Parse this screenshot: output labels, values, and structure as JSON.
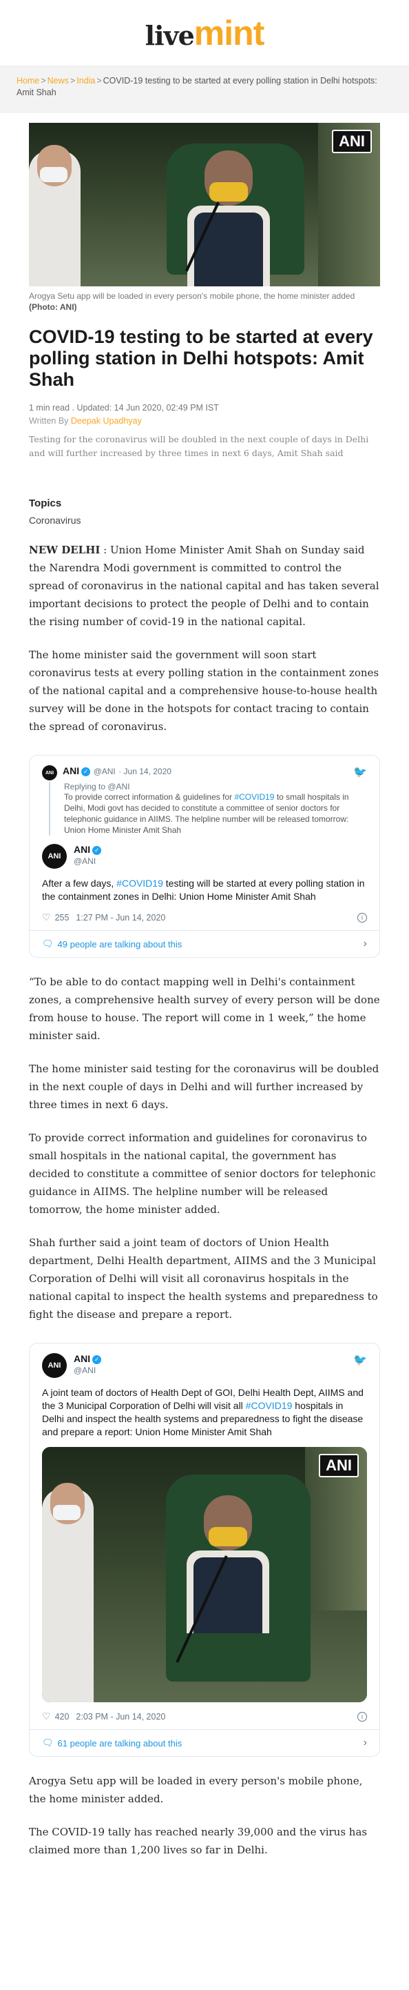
{
  "header": {
    "logo_live": "live",
    "logo_mint": "mint",
    "brand_color": "#f7a823"
  },
  "breadcrumb": {
    "home": "Home",
    "news": "News",
    "india": "India",
    "sep": ">",
    "current": "COVID-19 testing to be started at every polling station in Delhi hotspots: Amit Shah"
  },
  "hero": {
    "ani_tag": "ANI",
    "caption": "Arogya Setu app will be loaded in every person's mobile phone, the home minister added",
    "caption_credit": "(Photo: ANI)"
  },
  "article": {
    "title": "COVID-19 testing to be started at every polling station in Delhi hotspots: Amit Shah",
    "meta": "1 min read . Updated: 14 Jun 2020, 02:49 PM IST",
    "byline_prefix": "Written By",
    "author": "Deepak Upadhyay",
    "summary": "Testing for the coronavirus will be doubled in the next couple of days in Delhi and will further increased by three times in next 6 days, Amit Shah said"
  },
  "topics": {
    "heading": "Topics",
    "tag": "Coronavirus"
  },
  "body": {
    "p1_lead": "NEW DELHI",
    "p1_rest": " : Union Home Minister Amit Shah on Sunday said the Narendra Modi government is committed to control the spread of coronavirus in the national capital and has taken several important decisions to protect the people of Delhi and to contain the rising number of covid-19 in the national capital.",
    "p2": "The home minister said the government will soon start coronavirus tests at every polling station in the containment zones of the national capital and a comprehensive house-to-house health survey will be done in the hotspots for contact tracing to contain the spread of coronavirus.",
    "p3": "“To be able to do contact mapping well in Delhi's containment zones, a comprehensive health survey of every person will be done from house to house. The report will come in 1 week,” the home minister said.",
    "p4": "The home minister said testing for the coronavirus will be doubled in the next couple of days in Delhi and will further increased by three times in next 6 days.",
    "p5": "To provide correct information and guidelines for coronavirus to small hospitals in the national capital, the government has decided to constitute a committee of senior doctors for telephonic guidance in AIIMS. The helpline number will be released tomorrow, the home minister added.",
    "p6": "Shah further said a joint team of doctors of Union Health department, Delhi Health department, AIIMS and the 3 Municipal Corporation of Delhi will visit all coronavirus hospitals in the national capital to inspect the health systems and preparedness to fight the disease and prepare a report.",
    "p7": "Arogya Setu app will be loaded in every person's mobile phone, the home minister added.",
    "p8": "The COVID-19 tally has reached nearly 39,000 and the virus has claimed more than 1,200 lives so far in Delhi."
  },
  "tweet1": {
    "quoted_name": "ANI",
    "quoted_handle": "@ANI",
    "quoted_date": "· Jun 14, 2020",
    "reply_to": "Replying to @ANI",
    "quoted_text_a": "To provide correct information & guidelines for ",
    "quoted_hashtag": "#COVID19",
    "quoted_text_b": " to small hospitals in Delhi, Modi govt has decided to constitute a committee of senior doctors for telephonic guidance in AIIMS. The helpline number will be released tomorrow: Union Home Minister Amit Shah",
    "name": "ANI",
    "handle": "@ANI",
    "text_a": "After a few days, ",
    "hashtag": "#COVID19",
    "text_b": " testing will be started at every polling station in the containment zones in Delhi: Union Home Minister Amit Shah",
    "likes": "255",
    "time": "1:27 PM - Jun 14, 2020",
    "talk": "49 people are talking about this"
  },
  "tweet2": {
    "name": "ANI",
    "handle": "@ANI",
    "text_a": "A joint team of doctors of Health Dept of GOI, Delhi Health Dept, AIIMS and the 3 Municipal Corporation of Delhi will visit all ",
    "hashtag": "#COVID19",
    "text_b": " hospitals in Delhi and inspect the health systems and preparedness to fight the disease and prepare a report: Union Home Minister Amit Shah",
    "ani_tag": "ANI",
    "likes": "420",
    "time": "2:03 PM - Jun 14, 2020",
    "talk": "61 people are talking about this"
  },
  "icons": {
    "avatar": "ANI",
    "bird": "🐦",
    "check": "✓",
    "heart": "♡",
    "info": "i",
    "bubble": "🗨",
    "chevron": "›"
  }
}
